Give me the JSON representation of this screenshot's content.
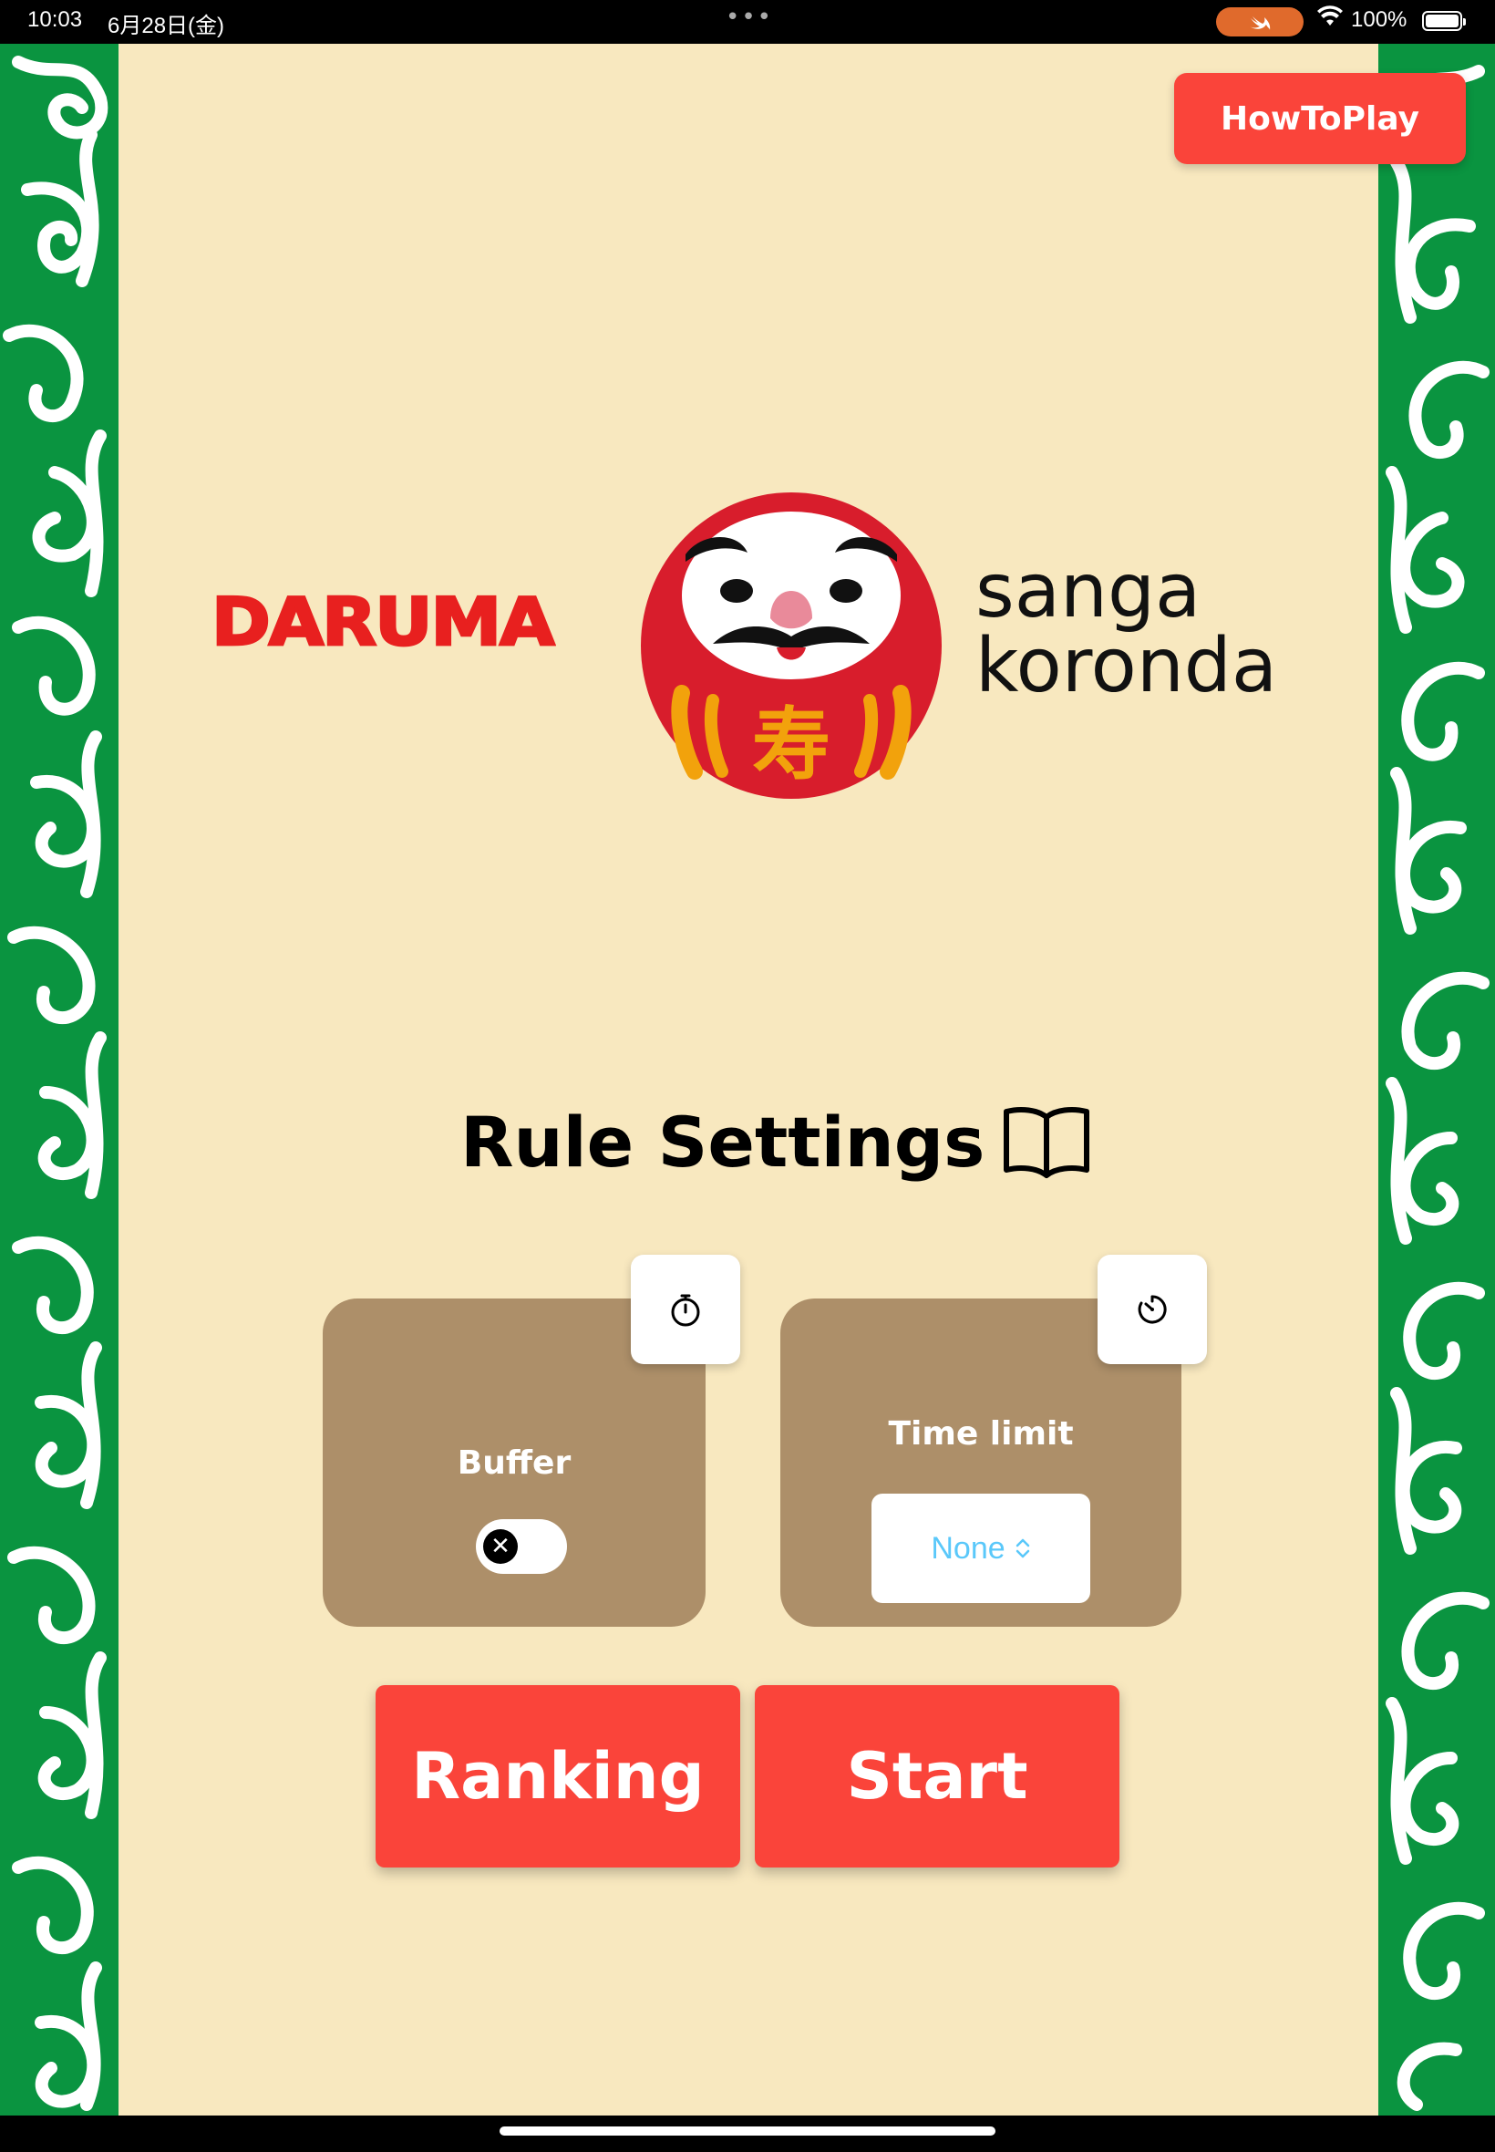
{
  "status_bar": {
    "time": "10:03",
    "date": "6月28日(金)",
    "dots": "•••",
    "battery": "100%"
  },
  "header": {
    "howto_label": "HowToPlay"
  },
  "logo": {
    "daruma": "DARUMA",
    "sanga": "sanga",
    "koronda": "koronda",
    "kanji": "寿"
  },
  "rules": {
    "title": "Rule Settings",
    "buffer": {
      "label": "Buffer",
      "enabled": false,
      "icon": "stopwatch-icon"
    },
    "time_limit": {
      "label": "Time limit",
      "value": "None",
      "icon": "timer-icon"
    }
  },
  "actions": {
    "ranking_label": "Ranking",
    "start_label": "Start"
  },
  "colors": {
    "background": "#f8e8bf",
    "border_green": "#0a9440",
    "button_red": "#fa443a",
    "card_brown": "#ad8f69",
    "logo_red": "#e8201f",
    "select_text": "#5ac8fa"
  }
}
